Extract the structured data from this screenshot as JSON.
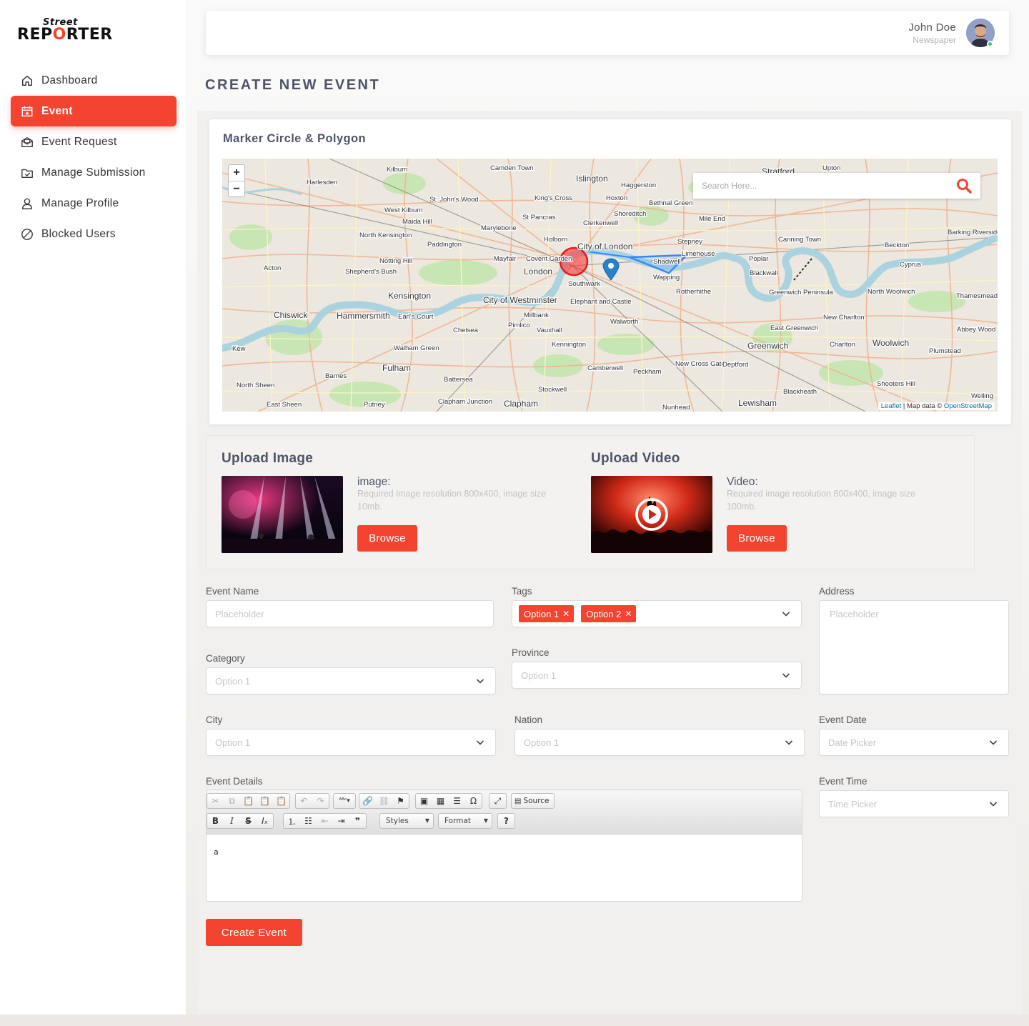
{
  "brand": {
    "top": "Street",
    "main_pre": "REP",
    "main_o": "O",
    "main_post": "RTER"
  },
  "sidebar": {
    "items": [
      {
        "label": "Dashboard",
        "icon": "home-icon"
      },
      {
        "label": "Event",
        "icon": "calendar-icon",
        "active": true
      },
      {
        "label": "Event Request",
        "icon": "mail-open-icon"
      },
      {
        "label": "Manage Submission",
        "icon": "folder-check-icon"
      },
      {
        "label": "Manage Profile",
        "icon": "user-icon"
      },
      {
        "label": "Blocked Users",
        "icon": "block-icon"
      }
    ]
  },
  "header": {
    "user_name": "John Doe",
    "user_role": "Newspaper"
  },
  "page": {
    "title": "CREATE NEW EVENT"
  },
  "map": {
    "card_title": "Marker Circle & Polygon",
    "zoom_in": "+",
    "zoom_out": "−",
    "search_placeholder": "Search Here...",
    "attribution_leaflet": "Leaflet",
    "attribution_sep": " | Map data © ",
    "attribution_osm": "OpenStreetMap",
    "places": [
      "Kilburn",
      "Camden Town",
      "Islington",
      "Stratford",
      "Upton",
      "Barking",
      "Harlesden",
      "St. John's Wood",
      "King's Cross",
      "Haggerston",
      "Hoxton",
      "Bethnal Green",
      "West Kilburn",
      "Maida Hill",
      "St Pancras",
      "Clerkenwell",
      "Shoreditch",
      "Mile End",
      "Marylebone",
      "North Kensington",
      "Paddington",
      "Holborn",
      "City of London",
      "Stepney",
      "Canning Town",
      "Beckton",
      "Barking Riverside",
      "Notting Hill",
      "Mayfair",
      "Covent Garden",
      "Limehouse",
      "Poplar",
      "Acton",
      "Shepherd's Bush",
      "London",
      "Southwark",
      "Shadwell",
      "Wapping",
      "Blackwall",
      "Cyprus",
      "Kensington",
      "City of Westminster",
      "Elephant and Castle",
      "Rotherhithe",
      "Greenwich Peninsula",
      "North Woolwich",
      "Thamesmead",
      "Chiswick",
      "Hammersmith",
      "Earl's Court",
      "Millbank",
      "Pimlico",
      "Walworth",
      "New Charlton",
      "Chelsea",
      "Vauxhall",
      "East Greenwich",
      "Abbey Wood",
      "Kew",
      "Kennington",
      "Greenwich",
      "Charlton",
      "Woolwich",
      "Plumstead",
      "Walham Green",
      "Fulham",
      "Camberwell",
      "Peckham",
      "New Cross Gate",
      "Deptford",
      "Barnes",
      "Battersea",
      "Stockwell",
      "Shooters Hill",
      "North Sheen",
      "Clapham Junction",
      "Blackheath",
      "East Sheen",
      "Putney",
      "Clapham",
      "Nunhead",
      "Lewisham",
      "Welling"
    ]
  },
  "upload": {
    "image": {
      "title": "Upload Image",
      "label": "image:",
      "hint": "Required image resolution 800x400, image size 10mb.",
      "button": "Browse"
    },
    "video": {
      "title": "Upload Video",
      "label": "Video:",
      "hint": "Required image resolution 800x400, image size 100mb.",
      "button": "Browse"
    }
  },
  "form": {
    "event_name": {
      "label": "Event Name",
      "placeholder": "Placeholder"
    },
    "tags": {
      "label": "Tags",
      "values": [
        "Option 1",
        "Option 2"
      ]
    },
    "address": {
      "label": "Address",
      "placeholder": "Placeholder"
    },
    "category": {
      "label": "Category",
      "value": "Option 1"
    },
    "province": {
      "label": "Province",
      "value": "Option 1"
    },
    "city": {
      "label": "City",
      "value": "Option 1"
    },
    "nation": {
      "label": "Nation",
      "value": "Option 1"
    },
    "event_date": {
      "label": "Event Date",
      "value": "Date Picker"
    },
    "event_time": {
      "label": "Event Time",
      "value": "Time Picker"
    },
    "event_details": {
      "label": "Event Details",
      "source_label": "Source",
      "styles_label": "Styles",
      "format_label": "Format",
      "content": "a"
    },
    "submit": "Create Event"
  },
  "colors": {
    "accent": "#f24431",
    "title": "#4d5468",
    "status_online": "#2ecc71"
  }
}
